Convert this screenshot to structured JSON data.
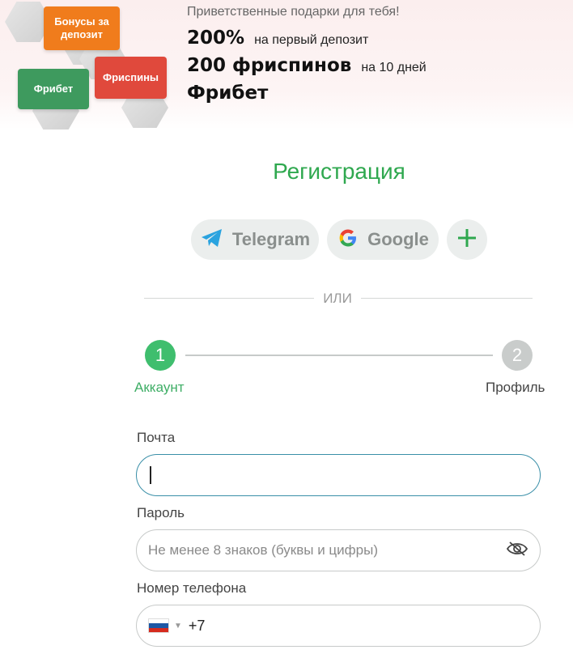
{
  "banner": {
    "tiles": {
      "deposit": "Бонусы за депозит",
      "freebet": "Фрибет",
      "spins": "Фриспины"
    },
    "greeting": "Приветственные подарки для тебя!",
    "offer1": {
      "big": "200%",
      "small": "на первый депозит"
    },
    "offer2": {
      "big": "200 фриспинов",
      "small": "на 10 дней"
    },
    "offer3": {
      "big": "Фрибет"
    },
    "colors": {
      "deposit": "#f07c1c",
      "freebet": "#3e9a5e",
      "spins": "#e0493c"
    }
  },
  "registration": {
    "title": "Регистрация",
    "social": {
      "telegram": "Telegram",
      "google": "Google",
      "more_icon": "plus-icon"
    },
    "divider": "ИЛИ"
  },
  "stepper": {
    "step1": {
      "number": "1",
      "label": "Аккаунт",
      "state": "active"
    },
    "step2": {
      "number": "2",
      "label": "Профиль",
      "state": "inactive"
    },
    "accent": "#3fbe6e"
  },
  "form": {
    "email": {
      "label": "Почта",
      "value": ""
    },
    "password": {
      "label": "Пароль",
      "placeholder": "Не менее 8 знаков (буквы и цифры)",
      "icon": "eye-slash-icon"
    },
    "phone": {
      "label": "Номер телефона",
      "country": "RU",
      "code": "+7"
    }
  }
}
